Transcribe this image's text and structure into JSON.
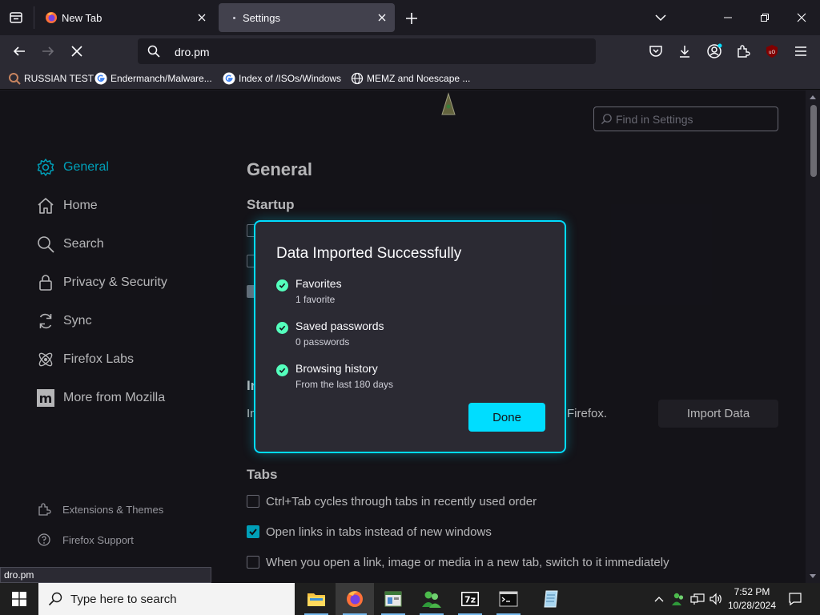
{
  "browser": {
    "tabs": [
      {
        "title": "New Tab",
        "active": false
      },
      {
        "title": "Settings",
        "active": true
      }
    ],
    "url": "dro.pm",
    "bookmarks": [
      {
        "label": "RUSSIAN TEST",
        "icon": "magnifier-icon"
      },
      {
        "label": "Endermanch/Malware...",
        "icon": "google-icon"
      },
      {
        "label": "Index of /ISOs/Windows",
        "icon": "google-icon"
      },
      {
        "label": "MEMZ and Noescape ...",
        "icon": "globe-icon"
      }
    ]
  },
  "settings": {
    "search_placeholder": "Find in Settings",
    "categories": [
      {
        "label": "General",
        "icon": "gear-icon",
        "active": true
      },
      {
        "label": "Home",
        "icon": "home-icon"
      },
      {
        "label": "Search",
        "icon": "search-icon"
      },
      {
        "label": "Privacy & Security",
        "icon": "lock-icon"
      },
      {
        "label": "Sync",
        "icon": "sync-icon"
      },
      {
        "label": "Firefox Labs",
        "icon": "flask-icon"
      },
      {
        "label": "More from Mozilla",
        "icon": "mozilla-icon"
      }
    ],
    "footer_links": [
      {
        "label": "Extensions & Themes",
        "icon": "puzzle-icon"
      },
      {
        "label": "Firefox Support",
        "icon": "help-icon"
      }
    ],
    "page_title": "General",
    "startup_heading": "Startup",
    "import_fragment_heading": "In",
    "import_fragment_text": "In",
    "import_fragment_tail": "Firefox.",
    "import_button": "Import Data",
    "tabs_heading": "Tabs",
    "tab_options": [
      {
        "label": "Ctrl+Tab cycles through tabs in recently used order",
        "checked": false
      },
      {
        "label": "Open links in tabs instead of new windows",
        "checked": true
      },
      {
        "label": "When you open a link, image or media in a new tab, switch to it immediately",
        "checked": false
      }
    ]
  },
  "status_url": "dro.pm",
  "dialog": {
    "title": "Data Imported Successfully",
    "items": [
      {
        "label": "Favorites",
        "detail": "1 favorite"
      },
      {
        "label": "Saved passwords",
        "detail": "0 passwords"
      },
      {
        "label": "Browsing history",
        "detail": "From the last 180 days"
      }
    ],
    "done_button": "Done"
  },
  "taskbar": {
    "search_placeholder": "Type here to search",
    "apps": [
      "file-explorer-icon",
      "firefox-icon",
      "app-window-icon",
      "people-icon",
      "7zip-icon",
      "terminal-icon",
      "notepad-icon"
    ],
    "active_app": "firefox-icon",
    "time": "7:52 PM",
    "date": "10/28/2024"
  },
  "colors": {
    "accent": "#00ddff",
    "success": "#54ffbd",
    "background": "#1c1b22",
    "toolbar": "#2b2a33"
  }
}
